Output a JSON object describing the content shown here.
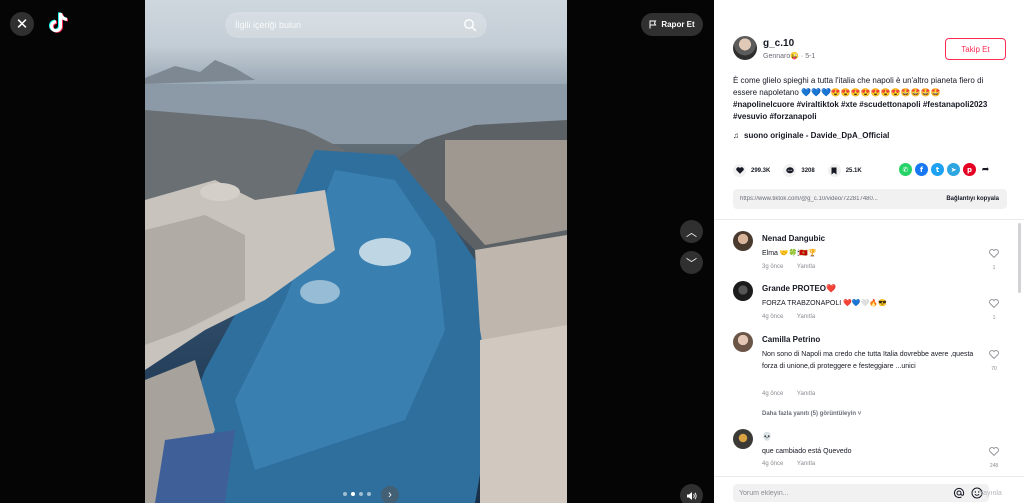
{
  "left": {
    "close_icon": "close-icon",
    "logo_icon": "tiktok-logo-icon",
    "report_label": "Rapor Et",
    "search": {
      "placeholder": "İlgili içeriği bulun"
    }
  },
  "author": {
    "username": "g_c.10",
    "nickname": "Gennaro😜",
    "date": "5-1",
    "follow_label": "Takip Et"
  },
  "caption": "È come glielo spieghi a tutta l'italia che napoli è un'altro pianeta fiero di essere napoletano 💙💙💙😍😍😍😍😍😍😍🤩🤩🤩🤩",
  "hashtags": "#napolinelcuore #viraltiktok #xte #scudettonapoli #festanapoli2023 #vesuvio #forzanapoli",
  "music": "suono originale - Davide_DpA_Official",
  "stats": {
    "likes": "299.3K",
    "comments": "3208",
    "saves": "25.1K"
  },
  "link": {
    "url": "https://www.tiktok.com/@g_c.10/video/722817480...",
    "copy_label": "Bağlantıyı kopyala"
  },
  "comments": [
    {
      "user": "Nenad Dangubic",
      "text": "Elma 🤝🍀🕯🇲🇪🏆",
      "time": "3g önce",
      "reply": "Yanıtla",
      "likes": "1"
    },
    {
      "user": "Grande  PROTEO❤️",
      "text": "FORZA TRABZONAPOLI ❤️💙🤍🔥😎",
      "time": "4g önce",
      "reply": "Yanıtla",
      "likes": "1"
    },
    {
      "user": "Camilla Petrino",
      "text": "Non sono di Napoli ma credo che tutta Italia dovrebbe avere ,questa forza di unione,di proteggere e festeggiare ...unici",
      "time": "4g önce",
      "reply": "Yanıtla",
      "likes": "70"
    },
    {
      "user": "💀",
      "text": "que cambiado está Quevedo",
      "time": "4g önce",
      "reply": "Yanıtla",
      "likes": "248"
    }
  ],
  "more_replies": "Daha fazla yanıtı (5) görüntüleyin",
  "comment_bar": {
    "placeholder": "Yorum ekleyin...",
    "post_label": "Yayınla"
  }
}
